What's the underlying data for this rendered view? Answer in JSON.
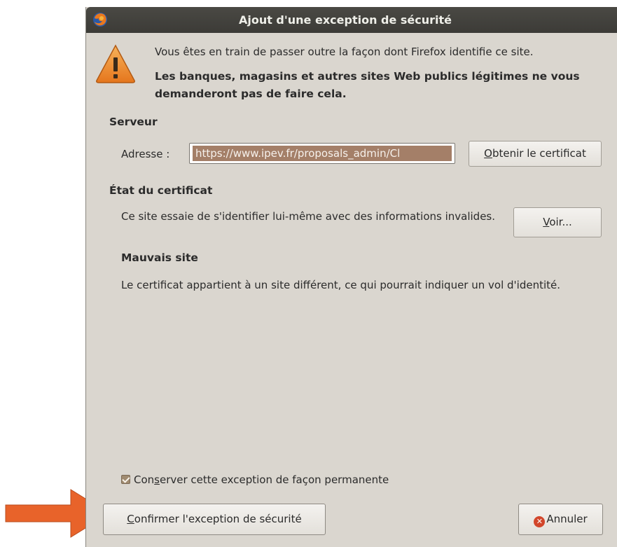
{
  "dialog": {
    "title": "Ajout d'une exception de sécurité",
    "close_glyph": "×",
    "app_icon": "firefox-icon",
    "warning_icon": "warning-triangle-icon",
    "warning_line1": "Vous êtes en train de passer outre la façon dont Firefox identifie ce site.",
    "warning_line2": "Les banques, magasins et autres sites Web publics légitimes ne vous demanderont pas de faire cela."
  },
  "server": {
    "heading": "Serveur",
    "address_label": "Adresse :",
    "address_value": "https://www.ipev.fr/proposals_admin/Cl",
    "get_certificate": {
      "mnemonic": "O",
      "rest": "btenir le certificat"
    }
  },
  "certificate_status": {
    "heading": "État du certificat",
    "description": "Ce site essaie de s'identifier lui-même avec des informations invalides.",
    "view_button": {
      "mnemonic": "V",
      "rest": "oir..."
    },
    "bad_site_heading": "Mauvais site",
    "bad_site_description": "Le certificat appartient à un site différent, ce qui pourrait indiquer un vol d'identité."
  },
  "permanent": {
    "checked": true,
    "pre": "Con",
    "mnemonic": "s",
    "post": "erver cette exception de façon permanente"
  },
  "footer": {
    "confirm": {
      "mnemonic": "C",
      "rest": "onfirmer l'exception de sécurité"
    },
    "cancel_label": "Annuler",
    "cancel_icon": "cancel-icon"
  },
  "annotation": {
    "arrow_color": "#e8632a"
  },
  "colors": {
    "titlebar": "#3c3b37",
    "dialog_bg": "#dad6cf",
    "selection": "#a47f68",
    "cancel_red": "#d2462b"
  }
}
